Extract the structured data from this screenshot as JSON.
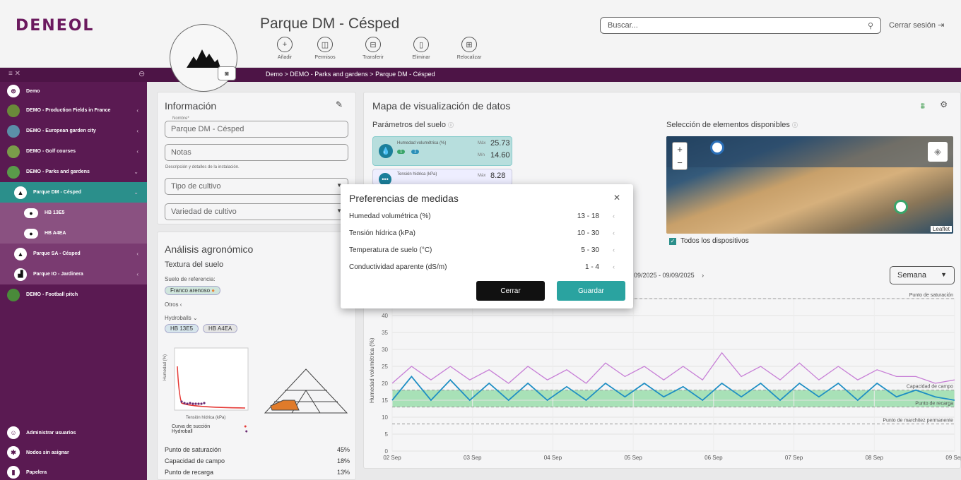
{
  "app": {
    "logo": "DENEOL",
    "search_placeholder": "Buscar...",
    "logout": "Cerrar sesión"
  },
  "page": {
    "title": "Parque DM - Césped"
  },
  "actions": [
    {
      "label": "Añadir",
      "icon": "+"
    },
    {
      "label": "Permisos",
      "icon": "◫"
    },
    {
      "label": "Transferir",
      "icon": "⊟"
    },
    {
      "label": "Eliminar",
      "icon": "▯"
    },
    {
      "label": "Relocalizar",
      "icon": "⊞"
    }
  ],
  "breadcrumb": {
    "text": "Demo  >  DEMO - Parks and gardens  >  Parque DM - Césped"
  },
  "sidebar": {
    "items": [
      {
        "label": "Demo",
        "chev": ""
      },
      {
        "label": "DEMO - Production Fields in France",
        "chev": "‹"
      },
      {
        "label": "DEMO - European garden city",
        "chev": "‹"
      },
      {
        "label": "DEMO - Golf courses",
        "chev": "‹"
      },
      {
        "label": "DEMO - Parks and gardens",
        "chev": "⌄"
      },
      {
        "label": "Parque DM - Césped",
        "chev": "⌄"
      },
      {
        "label": "HB 13E5",
        "chev": ""
      },
      {
        "label": "HB A4EA",
        "chev": ""
      },
      {
        "label": "Parque SA - Césped",
        "chev": "‹"
      },
      {
        "label": "Parque IO - Jardinera",
        "chev": "‹"
      },
      {
        "label": "DEMO - Football pitch",
        "chev": ""
      }
    ],
    "bottom": [
      {
        "label": "Administrar usuarios"
      },
      {
        "label": "Nodos sin asignar"
      },
      {
        "label": "Papelera"
      }
    ]
  },
  "info": {
    "title": "Información",
    "name_label": "Nombre*",
    "name_value": "Parque DM - Césped",
    "notes_placeholder": "Notas",
    "notes_help": "Descripción y detalles de la instalación.",
    "crop_type": "Tipo de cultivo",
    "crop_variety": "Variedad de cultivo"
  },
  "agro": {
    "title": "Análisis agronómico",
    "texture_title": "Textura del suelo",
    "ref_label": "Suelo de referencia:",
    "ref_value": "Franco arenoso",
    "others": "Otros",
    "hydroballs": "Hydroballs",
    "hb_tags": [
      "HB 13E5",
      "HB A4EA"
    ],
    "plot_ylabel": "Humedad (%)",
    "plot_xlabel": "Tensión hídrica (kPa)",
    "legend": [
      {
        "label": "Curva de succión",
        "color": "#e53935"
      },
      {
        "label": "Hydroball",
        "color": "#6a2a72"
      }
    ],
    "stats": [
      {
        "label": "Punto de saturación",
        "value": "45%"
      },
      {
        "label": "Capacidad de campo",
        "value": "18%"
      },
      {
        "label": "Punto de recarga",
        "value": "13%"
      }
    ]
  },
  "map": {
    "title": "Mapa de visualización de datos",
    "soil_params": "Parámetros del suelo",
    "selection": "Selección de elementos disponibles",
    "all_devices": "Todos los dispositivos",
    "leaflet": "Leaflet",
    "param1": {
      "label": "Humedad volumétrica (%)",
      "max_label": "Máx",
      "max": "25.73",
      "min_label": "Mín",
      "min": "14.60",
      "b1": "1",
      "b2": "1"
    },
    "param2": {
      "label": "Tensión hídrica (kPa)",
      "max_label": "Máx",
      "max": "8.28"
    },
    "date_range": "09/2025 - 09/09/2025",
    "period": "Semana"
  },
  "modal": {
    "title": "Preferencias de medidas",
    "rows": [
      {
        "label": "Humedad volumétrica (%)",
        "value": "13 - 18"
      },
      {
        "label": "Tensión hídrica (kPa)",
        "value": "10 - 30"
      },
      {
        "label": "Temperatura de suelo (°C)",
        "value": "5 - 30"
      },
      {
        "label": "Conductividad aparente (dS/m)",
        "value": "1 - 4"
      }
    ],
    "close": "Cerrar",
    "save": "Guardar"
  },
  "colors": {
    "purple": "#5a1a52",
    "teal": "#2b8f8b",
    "band": "#8ed9a2",
    "line_purple": "#c77fd6",
    "line_blue": "#1f8fc4"
  },
  "chart_data": {
    "type": "line",
    "ylabel": "Humedad volumétrica (%)",
    "ylim": [
      0,
      45
    ],
    "yticks": [
      0,
      5,
      10,
      15,
      20,
      25,
      30,
      35,
      40,
      45
    ],
    "categories": [
      "02 Sep",
      "03 Sep",
      "04 Sep",
      "05 Sep",
      "06 Sep",
      "07 Sep",
      "08 Sep",
      "09 Sep"
    ],
    "annotations": [
      {
        "label": "Punto de saturación",
        "y": 45
      },
      {
        "label": "Capacidad de campo",
        "y": 18
      },
      {
        "label": "Punto de recarga",
        "y": 13
      },
      {
        "label": "Punto de marchitez permanente",
        "y": 8
      }
    ],
    "band": [
      13,
      18
    ],
    "series": [
      {
        "values": [
          20,
          25,
          21,
          25,
          21,
          24,
          20,
          25,
          21,
          24,
          20,
          26,
          22,
          25,
          21,
          25,
          21,
          29,
          22,
          25,
          21,
          26,
          21,
          25,
          21,
          24,
          22,
          22,
          20,
          21
        ]
      },
      {
        "values": [
          15,
          22,
          15,
          21,
          15,
          20,
          15,
          20,
          15,
          19,
          15,
          20,
          16,
          20,
          16,
          19,
          15,
          20,
          16,
          20,
          15,
          20,
          16,
          20,
          15,
          20,
          16,
          18,
          16,
          15
        ]
      }
    ]
  }
}
